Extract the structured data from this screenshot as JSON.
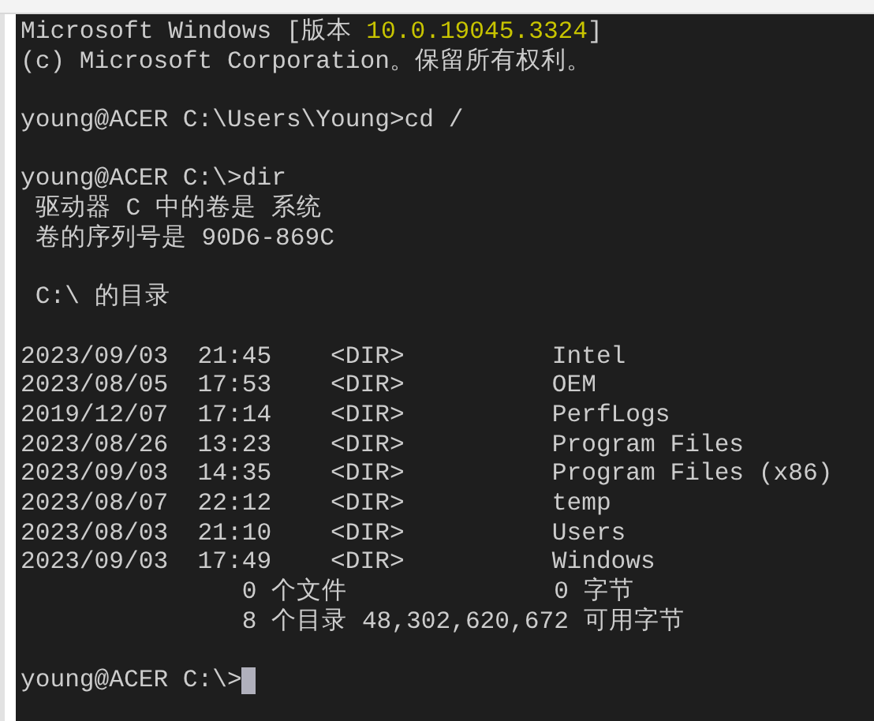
{
  "terminal": {
    "blocks": [
      [
        {
          "segments": [
            {
              "text": "Microsoft Windows [版本 "
            },
            {
              "text": "10.0.19045.3324",
              "kind": "highlight"
            },
            {
              "text": "]"
            }
          ]
        },
        {
          "segments": [
            {
              "text": "(c) Microsoft Corporation。保留所有权利。"
            }
          ]
        }
      ],
      [
        {
          "segments": [
            {
              "text": "young@ACER C:\\Users\\Young>cd /"
            }
          ]
        }
      ],
      [
        {
          "segments": [
            {
              "text": "young@ACER C:\\>dir"
            }
          ]
        },
        {
          "segments": [
            {
              "text": " 驱动器 C 中的卷是 系统"
            }
          ]
        },
        {
          "segments": [
            {
              "text": " 卷的序列号是 90D6-869C"
            }
          ]
        }
      ],
      [
        {
          "segments": [
            {
              "text": " C:\\ 的目录"
            }
          ]
        }
      ],
      [
        {
          "segments": [
            {
              "text": "2023/09/03  21:45    <DIR>          Intel"
            }
          ]
        },
        {
          "segments": [
            {
              "text": "2023/08/05  17:53    <DIR>          OEM"
            }
          ]
        },
        {
          "segments": [
            {
              "text": "2019/12/07  17:14    <DIR>          PerfLogs"
            }
          ]
        },
        {
          "segments": [
            {
              "text": "2023/08/26  13:23    <DIR>          Program Files"
            }
          ]
        },
        {
          "segments": [
            {
              "text": "2023/09/03  14:35    <DIR>          Program Files (x86)"
            }
          ]
        },
        {
          "segments": [
            {
              "text": "2023/08/07  22:12    <DIR>          temp"
            }
          ]
        },
        {
          "segments": [
            {
              "text": "2023/08/03  21:10    <DIR>          Users"
            }
          ]
        },
        {
          "segments": [
            {
              "text": "2023/09/03  17:49    <DIR>          Windows"
            }
          ]
        },
        {
          "segments": [
            {
              "text": "               0 个文件              0 字节"
            }
          ]
        },
        {
          "segments": [
            {
              "text": "               8 个目录 48,302,620,672 可用字节"
            }
          ]
        }
      ],
      [
        {
          "segments": [
            {
              "text": "young@ACER C:\\>"
            }
          ],
          "cursor": true
        }
      ]
    ]
  }
}
